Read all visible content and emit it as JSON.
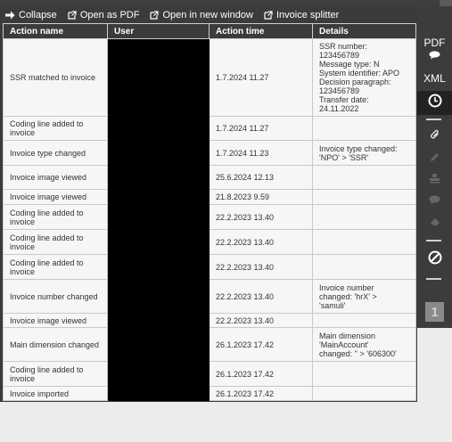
{
  "toolbar": {
    "collapse": "Collapse",
    "open_pdf": "Open as PDF",
    "open_new_window": "Open in new window",
    "invoice_splitter": "Invoice splitter"
  },
  "table": {
    "headers": {
      "action_name": "Action name",
      "user": "User",
      "action_time": "Action time",
      "details": "Details"
    },
    "rows": [
      {
        "action": "SSR matched to invoice",
        "time": "1.7.2024 11.27",
        "details": [
          "SSR number:",
          "123456789",
          "Message type: N",
          "System identifier: APO",
          "Decision paragraph:",
          "123456789",
          "Transfer date:",
          "24.11.2022"
        ]
      },
      {
        "action": "Coding line added to invoice",
        "time": "1.7.2024 11.27",
        "details": []
      },
      {
        "action": "Invoice type changed",
        "time": "1.7.2024 11.23",
        "details": [
          "Invoice type changed:",
          "'NPO' > 'SSR'"
        ]
      },
      {
        "action": "Invoice image viewed",
        "time": "25.6.2024 12.13",
        "details": []
      },
      {
        "action": "Invoice image viewed",
        "time": "21.8.2023 9.59",
        "details": []
      },
      {
        "action": "Coding line added to invoice",
        "time": "22.2.2023 13.40",
        "details": []
      },
      {
        "action": "Coding line added to invoice",
        "time": "22.2.2023 13.40",
        "details": []
      },
      {
        "action": "Coding line added to invoice",
        "time": "22.2.2023 13.40",
        "details": []
      },
      {
        "action": "Invoice number changed",
        "time": "22.2.2023 13.40",
        "details": [
          "Invoice number",
          "changed: 'hrX' >",
          "'samuli'"
        ]
      },
      {
        "action": "Invoice image viewed",
        "time": "22.2.2023 13.40",
        "details": []
      },
      {
        "action": "Main dimension changed",
        "time": "26.1.2023 17.42",
        "details": [
          "Main dimension",
          "'MainAccount'",
          "changed: '' > '606300'"
        ]
      },
      {
        "action": "Coding line added to invoice",
        "time": "26.1.2023 17.42",
        "details": []
      },
      {
        "action": "Invoice imported",
        "time": "26.1.2023 17.42",
        "details": []
      }
    ]
  },
  "sidebar": {
    "pdf_label": "PDF",
    "xml_label": "XML",
    "page_number": "1"
  },
  "icons": {
    "collapse": "arrow-right-icon",
    "open_pdf": "external-link-icon",
    "open_new_window": "external-link-icon",
    "invoice_splitter": "external-link-icon",
    "history": "clock-icon",
    "attach": "paperclip-icon",
    "edit": "pencil-icon",
    "stamp": "stamp-icon",
    "comment": "comment-icon",
    "erase": "eraser-icon",
    "block": "block-icon"
  }
}
